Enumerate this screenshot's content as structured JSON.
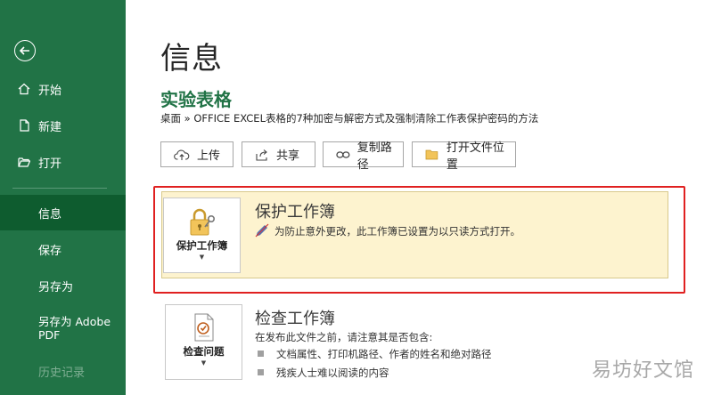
{
  "sidebar": {
    "items": [
      {
        "label": "开始"
      },
      {
        "label": "新建"
      },
      {
        "label": "打开"
      },
      {
        "label": "信息"
      },
      {
        "label": "保存"
      },
      {
        "label": "另存为"
      },
      {
        "label": "另存为 Adobe PDF"
      },
      {
        "label": "历史记录"
      }
    ],
    "bg_color": "#217346",
    "active_color": "#0e5c2f"
  },
  "main": {
    "page_title": "信息",
    "doc_title": "实验表格",
    "breadcrumb": "桌面 » OFFICE EXCEL表格的7种加密与解密方式及强制清除工作表保护密码的方法",
    "buttons": [
      {
        "label": "上传",
        "icon": "cloud-upload-icon"
      },
      {
        "label": "共享",
        "icon": "share-icon"
      },
      {
        "label": "复制路径",
        "icon": "link-icon"
      },
      {
        "label": "打开文件位置",
        "icon": "folder-icon"
      }
    ],
    "protect": {
      "tile_label": "保护工作簿",
      "title": "保护工作簿",
      "message": "为防止意外更改，此工作簿已设置为以只读方式打开。"
    },
    "inspect": {
      "tile_label": "检查问题",
      "title": "检查工作簿",
      "intro": "在发布此文件之前，请注意其是否包含:",
      "bullets": [
        "文档属性、打印机路径、作者的姓名和绝对路径",
        "残疾人士难以阅读的内容"
      ]
    }
  },
  "watermark": "易坊好文馆",
  "accent_color": "#217346",
  "highlight_color": "#e02020"
}
